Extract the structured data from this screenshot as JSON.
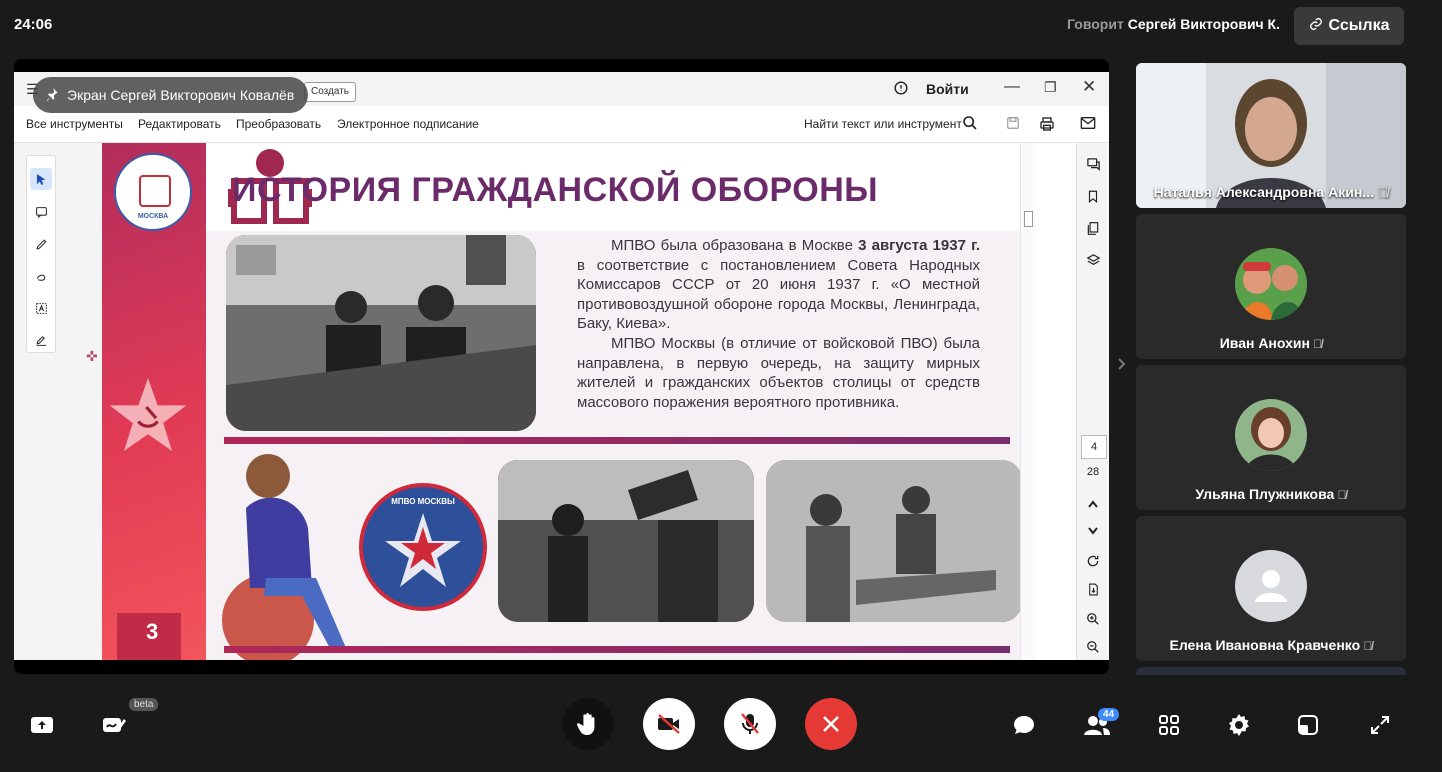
{
  "top_bar": {
    "time": "24:06",
    "speaking_prefix": "Говорит",
    "speaking_name": "Сергей Викторович К.",
    "link_button": "Ссылка"
  },
  "screen_share": {
    "label": "Экран Сергей Викторович Ковалёв",
    "app": {
      "create_button": "Создать",
      "signin": "Войти",
      "menu": [
        "Все инструменты",
        "Редактировать",
        "Преобразовать",
        "Электронное подписание"
      ],
      "search_placeholder": "Найти текст или инструмент",
      "page_current": "4",
      "page_total": "28"
    },
    "slide": {
      "title": "ИСТОРИЯ ГРАЖДАНСКОЙ ОБОРОНЫ",
      "para1_a": "МПВО была образована в Москве ",
      "para1_bold": "3 августа 1937 г.",
      "para1_b": " в соответствие с постановлением Совета Народных Комиссаров СССР от 20 июня 1937 г. «О местной противовоздушной обороне города Москвы, Ленинграда, Баку, Киева».",
      "para2": "МПВО Москвы (в отличие от войсковой ПВО) была направлена, в первую очередь, на защиту мирных жителей и гражданских объектов столицы от средств массового поражения вероятного противника.",
      "page_number": "3",
      "emblem_text": "МПВО МОСКВЫ",
      "logo_text": "МОСКВА"
    }
  },
  "participants": [
    {
      "name": "Наталья Александровна Акин...",
      "video": true
    },
    {
      "name": "Иван Анохин",
      "video": false
    },
    {
      "name": "Ульяна Плужникова",
      "video": false
    },
    {
      "name": "Елена Ивановна Кравченко",
      "video": false
    }
  ],
  "bottom_bar": {
    "beta_badge": "beta",
    "participants_count": "44"
  },
  "colors": {
    "background": "#1a1a1a",
    "end_call": "#e53935",
    "badge": "#3d8bfd",
    "slide_title": "#6b2a6a"
  }
}
